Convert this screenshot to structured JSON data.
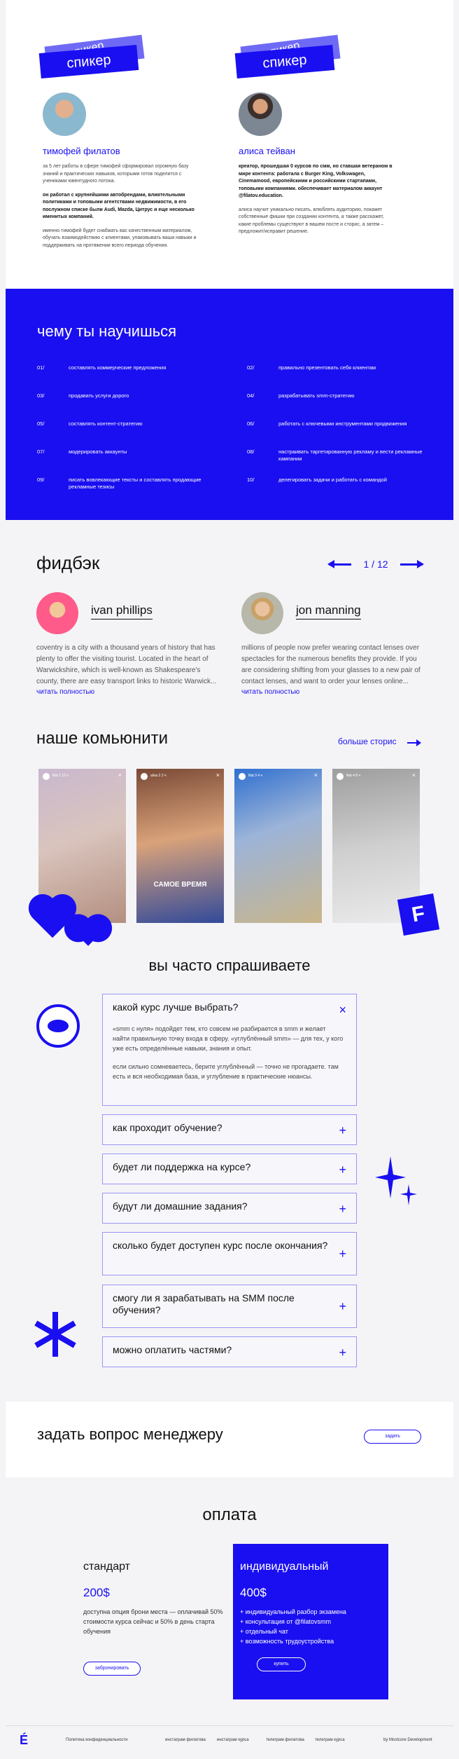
{
  "speakers": {
    "tag_label": "спикер",
    "tag_clip": "спикер",
    "items": [
      {
        "name": "тимофей филатов",
        "p1": "за 5 лет работы в сфере тимофей сформировал огромную базу знаний и практических навыков, которыми готов поделится с учениками ювентудного потока.",
        "p2": "он работал с крупнейшими автобрендами, влиятельными политиками и топовыми агентствами недвижимости, в его послужном списке были Audi, Mazda, Цитрус и еще несколько именитых компаний.",
        "p3": "именно тимофей будет снабжать вас качественным материалом, обучать взаимодействию с клиентами, упаковывать ваши навыки и поддерживать на протяжении всего периода обучения."
      },
      {
        "name": "алиса тейван",
        "p1": "креатор, прошедшая 0 курсов по смм, но ставшая ветераном в мире контента: работала с Burger King, Volkswagen, Cinemamood, европейскими и российскими стартапами, топовыми компаниями. обеспечивает материалом аккаунт @filatov.education.",
        "p2": "алиса научит уникально писать, влюблять аудиторию, покажет собственные фишки при создании контента, а также расскажет, какие проблемы существуют в вашем посте и сторис, а затем – предложит/исправит решение."
      }
    ]
  },
  "learn": {
    "title": "чему ты научишься",
    "items": [
      {
        "num": "01/",
        "text": "составлять коммерческие предложения"
      },
      {
        "num": "02/",
        "text": "правильно презентовать себя клиентам"
      },
      {
        "num": "03/",
        "text": "продавать услуги дорого"
      },
      {
        "num": "04/",
        "text": "разрабатывать smm-стратегию"
      },
      {
        "num": "05/",
        "text": "составлять контент-стратегию"
      },
      {
        "num": "06/",
        "text": "работать с ключевыми инструментами продвижения"
      },
      {
        "num": "07/",
        "text": "модерировать аккаунты"
      },
      {
        "num": "08/",
        "text": "настраивать таргетированную рекламу и вести рекламные кампании"
      },
      {
        "num": "09/",
        "text": "писать вовлекающие тексты и составлять продающие рекламные тезисы"
      },
      {
        "num": "10/",
        "text": "делегировать задачи и работать с командой"
      }
    ]
  },
  "feedback": {
    "title": "фидбэк",
    "counter": "1 / 12",
    "more": "читать полностью",
    "reviews": [
      {
        "name": "ivan phillips",
        "text": "coventry is a city with a thousand years of history that has plenty to offer the visiting tourist. Located in the heart of Warwickshire, which is well-known as Shakespeare's county, there are easy transport links to historic Warwick..."
      },
      {
        "name": "jon manning",
        "text": "millions of people now prefer wearing contact lenses over spectacles for the numerous benefits they provide. If you are considering shifting from your glasses to a new pair of contact lenses, and want to order your lenses online..."
      }
    ]
  },
  "community": {
    "title": "наше комьюнити",
    "more": "больше сторис",
    "stories": [
      {
        "user": "filat 1 13 ч",
        "caption": ""
      },
      {
        "user": "alisa 2 2 ч",
        "caption": "САМОЕ ВРЕМЯ"
      },
      {
        "user": "filat 3 4 ч",
        "caption": ""
      },
      {
        "user": "filat 4 8 ч",
        "caption": ""
      }
    ],
    "badge": "F"
  },
  "faq": {
    "title": "вы часто спрашиваете",
    "items": [
      {
        "q": "какой курс лучше выбрать?",
        "toggle": "×",
        "a1": "«smm с нуля» подойдет тем, кто совсем не разбирается в smm и желает найти правильную точку входа в сферу. «углублённый smm» — для тех, у кого уже есть определённые навыки, знания и опыт.",
        "a2": "если сильно сомневаетесь, берите углублённый — точно не прогадаете. там есть и вся необходимая база, и углубление в практические нюансы."
      },
      {
        "q": "как проходит обучение?",
        "toggle": "+"
      },
      {
        "q": "будет ли поддержка на курсе?",
        "toggle": "+"
      },
      {
        "q": "будут ли домашние задания?",
        "toggle": "+"
      },
      {
        "q": "сколько будет доступен курс после окончания?",
        "toggle": "+"
      },
      {
        "q": "смогу ли я зарабатывать на SMM после обучения?",
        "toggle": "+"
      },
      {
        "q": "можно оплатить частями?",
        "toggle": "+"
      }
    ]
  },
  "ask": {
    "title": "задать вопрос менеджеру",
    "button": "задать"
  },
  "payment": {
    "title": "оплата",
    "plans": [
      {
        "name": "стандарт",
        "price": "200$",
        "desc": "доступна опция брони места — оплачивай 50% стоимости курса сейчас и 50% в день старта обучения",
        "button": "забронировать"
      },
      {
        "name": "индивидуальный",
        "price": "400$",
        "features": [
          "+ индивидуальный разбор экзамена",
          "+ консультация от @filatovsmm",
          "+ отдельный чат",
          "+ возможность трудоустройства"
        ],
        "button": "купить"
      }
    ]
  },
  "footer": {
    "logo": "É",
    "links": [
      "Политика конфиденциальности",
      "инстаграм филатова",
      "инстаграм курса",
      "телеграм филатова",
      "телеграм курса"
    ],
    "credit": "by Mostcore Development"
  },
  "colors": {
    "accent": "#1a0ff0"
  }
}
